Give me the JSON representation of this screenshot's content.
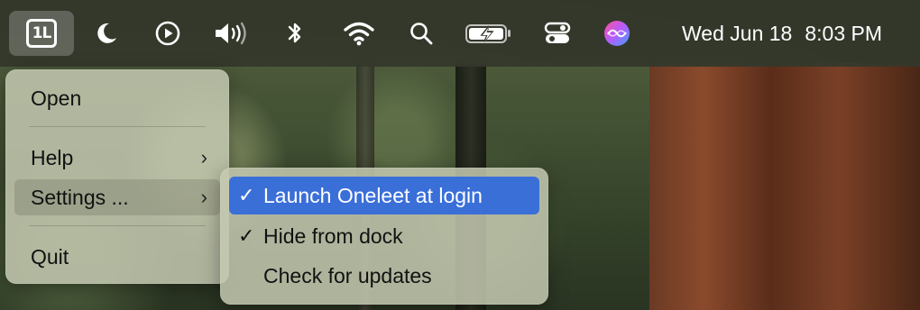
{
  "menubar": {
    "app_icon_text": "1L",
    "icons": [
      "moon-icon",
      "play-circle-icon",
      "speaker-icon",
      "bluetooth-icon",
      "wifi-icon",
      "search-icon",
      "battery-charging-icon",
      "control-center-icon",
      "siri-icon"
    ],
    "clock": {
      "date": "Wed Jun 18",
      "time": "8:03 PM"
    }
  },
  "main_menu": {
    "items": [
      {
        "label": "Open"
      },
      {
        "label": "Help",
        "has_submenu": true
      },
      {
        "label": "Settings ...",
        "has_submenu": true,
        "highlighted": true
      },
      {
        "label": "Quit"
      }
    ],
    "chevron": "›"
  },
  "settings_submenu": {
    "items": [
      {
        "label": "Launch Oneleet at login",
        "checked": true,
        "selected": true,
        "check": "✓"
      },
      {
        "label": "Hide from dock",
        "checked": true,
        "check": "✓"
      },
      {
        "label": "Check for updates",
        "checked": false,
        "check": ""
      }
    ]
  },
  "colors": {
    "menubar": "#34382C",
    "selection": "#3A6FD8",
    "menu_bg": "#C4C8B0"
  }
}
